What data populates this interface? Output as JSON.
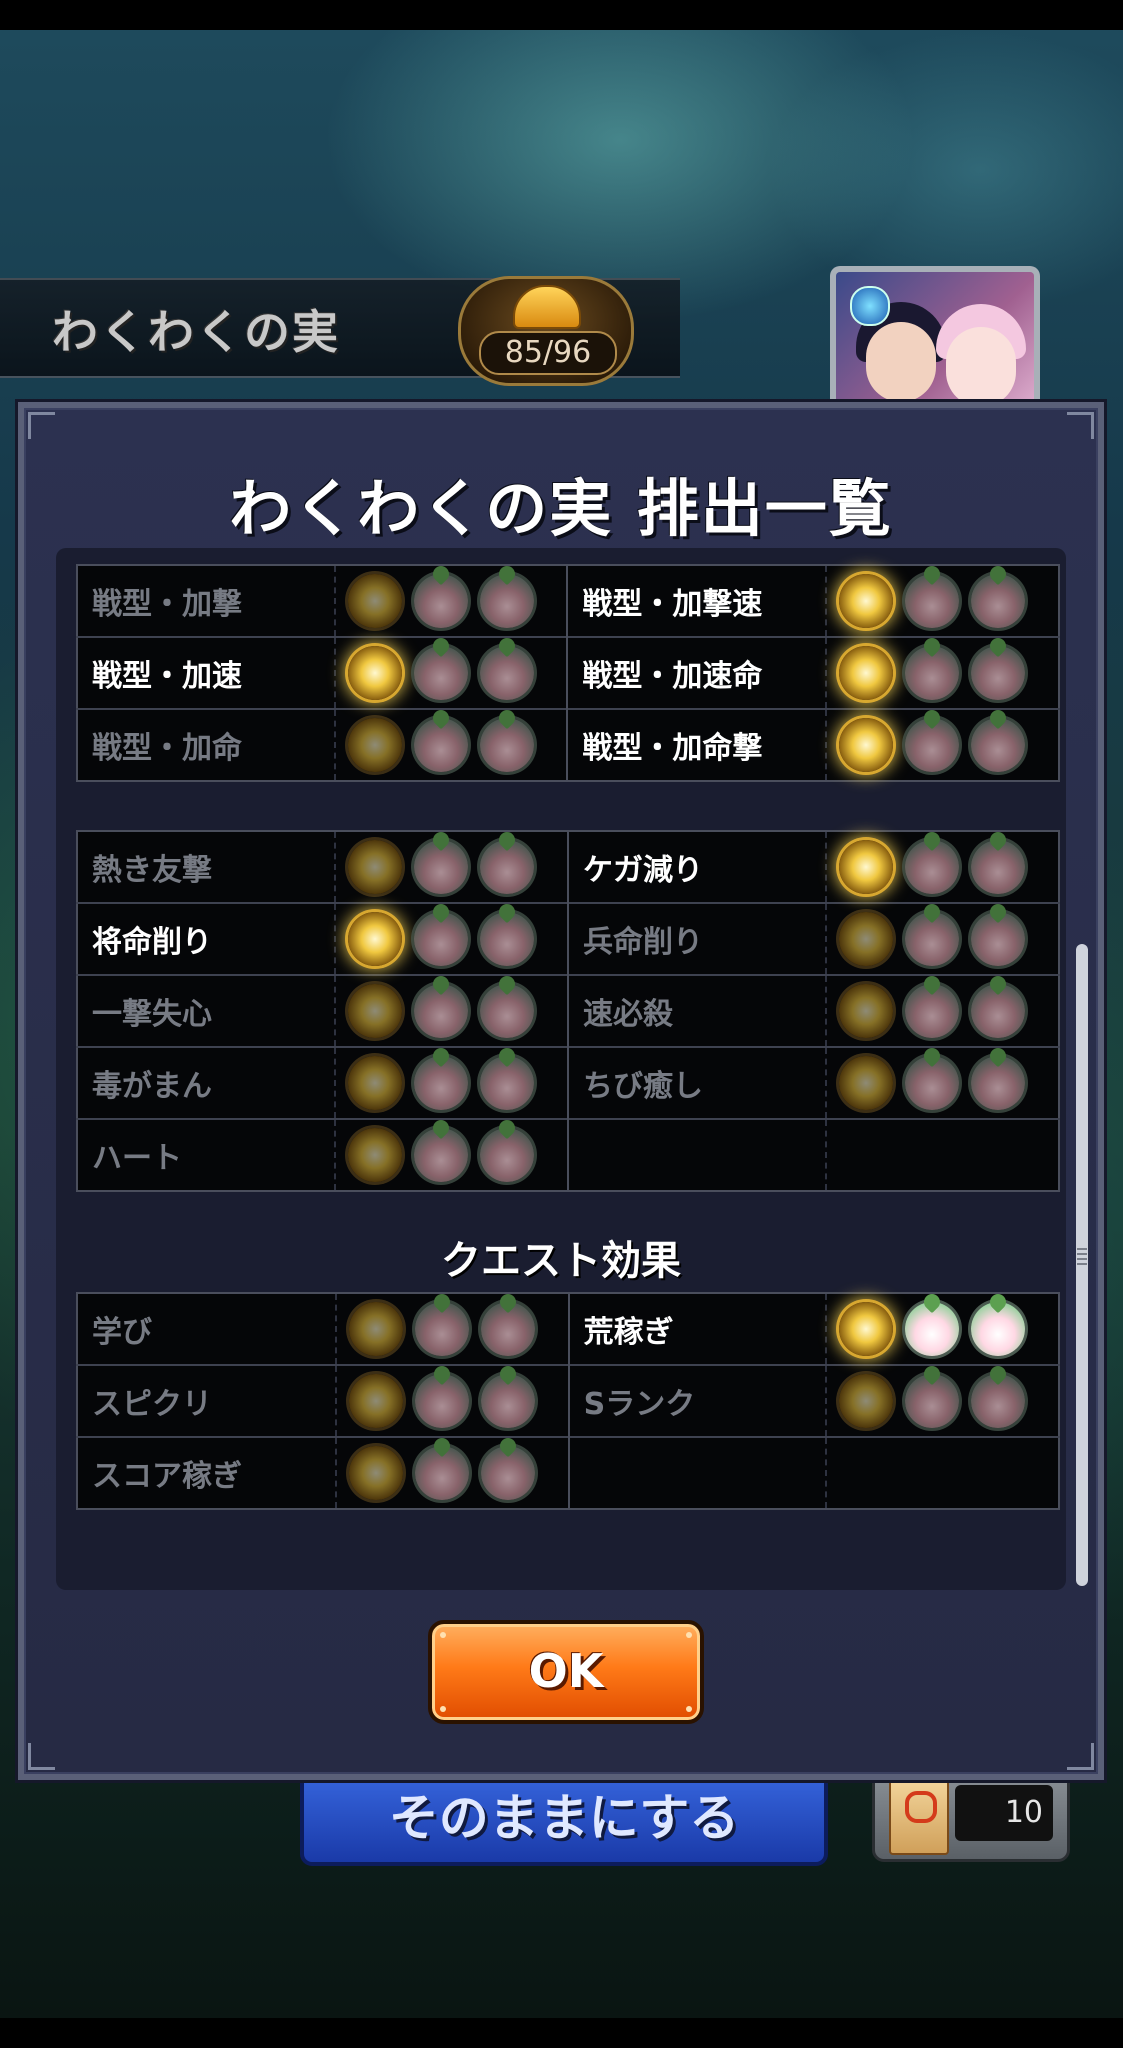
{
  "header": {
    "title": "わくわくの実",
    "counter": "85/96"
  },
  "dialog": {
    "title": "わくわくの実 排出一覧",
    "ok_label": "OK",
    "section1": [
      {
        "left": {
          "name": "戦型・加撃",
          "on": false,
          "star": false,
          "lotus1": false,
          "lotus2": false
        },
        "right": {
          "name": "戦型・加撃速",
          "on": true,
          "star": true,
          "lotus1": false,
          "lotus2": false
        }
      },
      {
        "left": {
          "name": "戦型・加速",
          "on": true,
          "star": true,
          "lotus1": false,
          "lotus2": false
        },
        "right": {
          "name": "戦型・加速命",
          "on": true,
          "star": true,
          "lotus1": false,
          "lotus2": false
        }
      },
      {
        "left": {
          "name": "戦型・加命",
          "on": false,
          "star": false,
          "lotus1": false,
          "lotus2": false
        },
        "right": {
          "name": "戦型・加命撃",
          "on": true,
          "star": true,
          "lotus1": false,
          "lotus2": false
        }
      }
    ],
    "section2": [
      {
        "left": {
          "name": "熱き友撃",
          "on": false,
          "star": false,
          "lotus1": false,
          "lotus2": false
        },
        "right": {
          "name": "ケガ減り",
          "on": true,
          "star": true,
          "lotus1": false,
          "lotus2": false
        }
      },
      {
        "left": {
          "name": "将命削り",
          "on": true,
          "star": true,
          "lotus1": false,
          "lotus2": false
        },
        "right": {
          "name": "兵命削り",
          "on": false,
          "star": false,
          "lotus1": false,
          "lotus2": false
        }
      },
      {
        "left": {
          "name": "一撃失心",
          "on": false,
          "star": false,
          "lotus1": false,
          "lotus2": false
        },
        "right": {
          "name": "速必殺",
          "on": false,
          "star": false,
          "lotus1": false,
          "lotus2": false
        }
      },
      {
        "left": {
          "name": "毒がまん",
          "on": false,
          "star": false,
          "lotus1": false,
          "lotus2": false
        },
        "right": {
          "name": "ちび癒し",
          "on": false,
          "star": false,
          "lotus1": false,
          "lotus2": false
        }
      },
      {
        "left": {
          "name": "ハート",
          "on": false,
          "star": false,
          "lotus1": false,
          "lotus2": false
        },
        "right": null
      }
    ],
    "quest_section_title": "クエスト効果",
    "section3": [
      {
        "left": {
          "name": "学び",
          "on": false,
          "star": false,
          "lotus1": false,
          "lotus2": false
        },
        "right": {
          "name": "荒稼ぎ",
          "on": true,
          "star": true,
          "lotus1": true,
          "lotus2": true
        }
      },
      {
        "left": {
          "name": "スピクリ",
          "on": false,
          "star": false,
          "lotus1": false,
          "lotus2": false
        },
        "right": {
          "name": "Sランク",
          "on": false,
          "star": false,
          "lotus1": false,
          "lotus2": false
        }
      },
      {
        "left": {
          "name": "スコア稼ぎ",
          "on": false,
          "star": false,
          "lotus1": false,
          "lotus2": false
        },
        "right": null
      }
    ]
  },
  "behind": {
    "keep_button": "そのままにする",
    "ticket_count": "10"
  },
  "icons": {
    "star": "gold-star-fruit-icon",
    "lotus": "lotus-fruit-icon"
  }
}
